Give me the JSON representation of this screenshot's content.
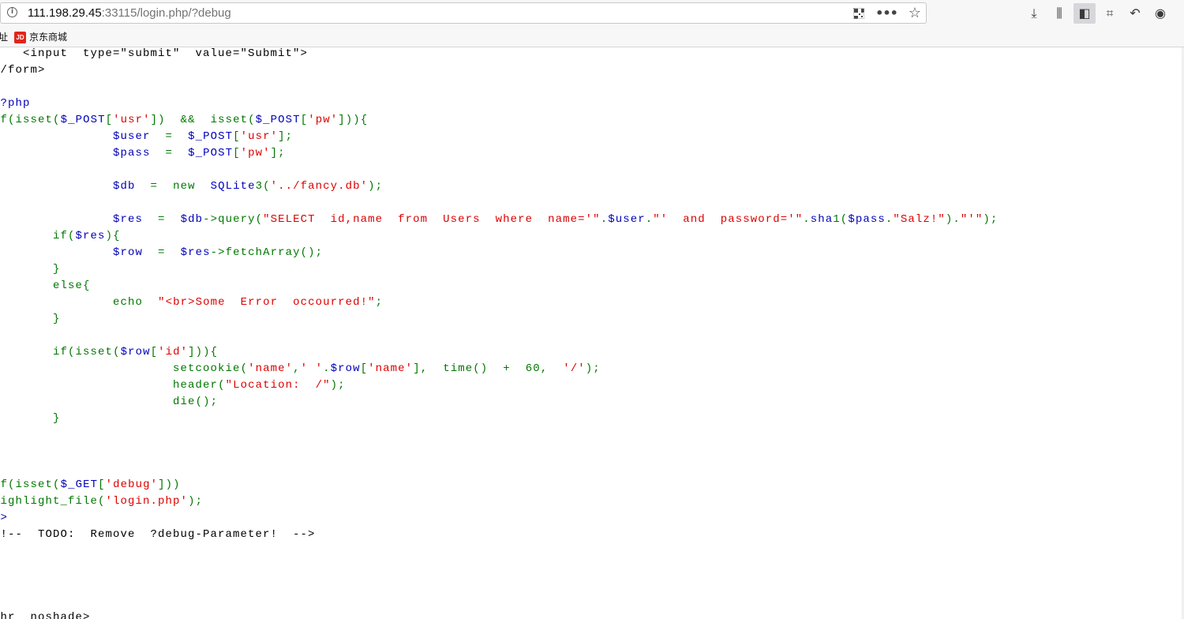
{
  "browser": {
    "url_host": "111.198.29.45",
    "url_rest": ":33115/login.php/?debug",
    "bookmark_partial": "址",
    "bookmark_jd_label": "京东商城",
    "jd_icon_text": "JD"
  },
  "source_lines": [
    {
      "text": "    <input  type=\"submit\"  value=\"Submit\">",
      "kind": "html"
    },
    {
      "text": "</form>",
      "kind": "html"
    },
    {
      "text": "",
      "kind": "html"
    },
    {
      "text": "<?php",
      "kind": "var"
    },
    {
      "text": "if(isset($_POST['usr'])  &&  isset($_POST['pw'])){",
      "kind": "mix1"
    },
    {
      "text": "                $user  =  $_POST['usr'];",
      "kind": "mix2"
    },
    {
      "text": "                $pass  =  $_POST['pw'];",
      "kind": "mix3"
    },
    {
      "text": "",
      "kind": "html"
    },
    {
      "text": "                $db  =  new  SQLite3('../fancy.db');",
      "kind": "mix4"
    },
    {
      "text": "",
      "kind": "html"
    },
    {
      "text": "                $res  =  $db->query(\"SELECT  id,name  from  Users  where  name='\".$user.\"'  and  password='\".sha1($pass.\"Salz!\").\"'\");",
      "kind": "mix5"
    },
    {
      "text": "        if($res){",
      "kind": "mix6"
    },
    {
      "text": "                $row  =  $res->fetchArray();",
      "kind": "mix7"
    },
    {
      "text": "        }",
      "kind": "def"
    },
    {
      "text": "        else{",
      "kind": "def"
    },
    {
      "text": "                echo  \"<br>Some  Error  occourred!\";",
      "kind": "mix8"
    },
    {
      "text": "        }",
      "kind": "def"
    },
    {
      "text": "",
      "kind": "html"
    },
    {
      "text": "        if(isset($row['id'])){",
      "kind": "mix9"
    },
    {
      "text": "                        setcookie('name',' '.$row['name'],  time()  +  60,  '/');",
      "kind": "mix10"
    },
    {
      "text": "                        header(\"Location:  /\");",
      "kind": "mix11"
    },
    {
      "text": "                        die();",
      "kind": "mix12"
    },
    {
      "text": "        }",
      "kind": "def"
    },
    {
      "text": "",
      "kind": "html"
    },
    {
      "text": "}",
      "kind": "def"
    },
    {
      "text": "",
      "kind": "html"
    },
    {
      "text": "if(isset($_GET['debug']))",
      "kind": "mix13"
    },
    {
      "text": "highlight_file('login.php');",
      "kind": "mix14"
    },
    {
      "text": "?>",
      "kind": "var"
    },
    {
      "text": "<!--  TODO:  Remove  ?debug-Parameter!  -->",
      "kind": "html"
    },
    {
      "text": "",
      "kind": "html"
    },
    {
      "text": "",
      "kind": "html"
    },
    {
      "text": "",
      "kind": "html"
    },
    {
      "text": "",
      "kind": "html"
    },
    {
      "text": "<hr  noshade>",
      "kind": "html"
    }
  ],
  "colors": {
    "html": "#000000",
    "keyword": "#007700",
    "variable": "#0000BB",
    "string": "#DD0000"
  }
}
